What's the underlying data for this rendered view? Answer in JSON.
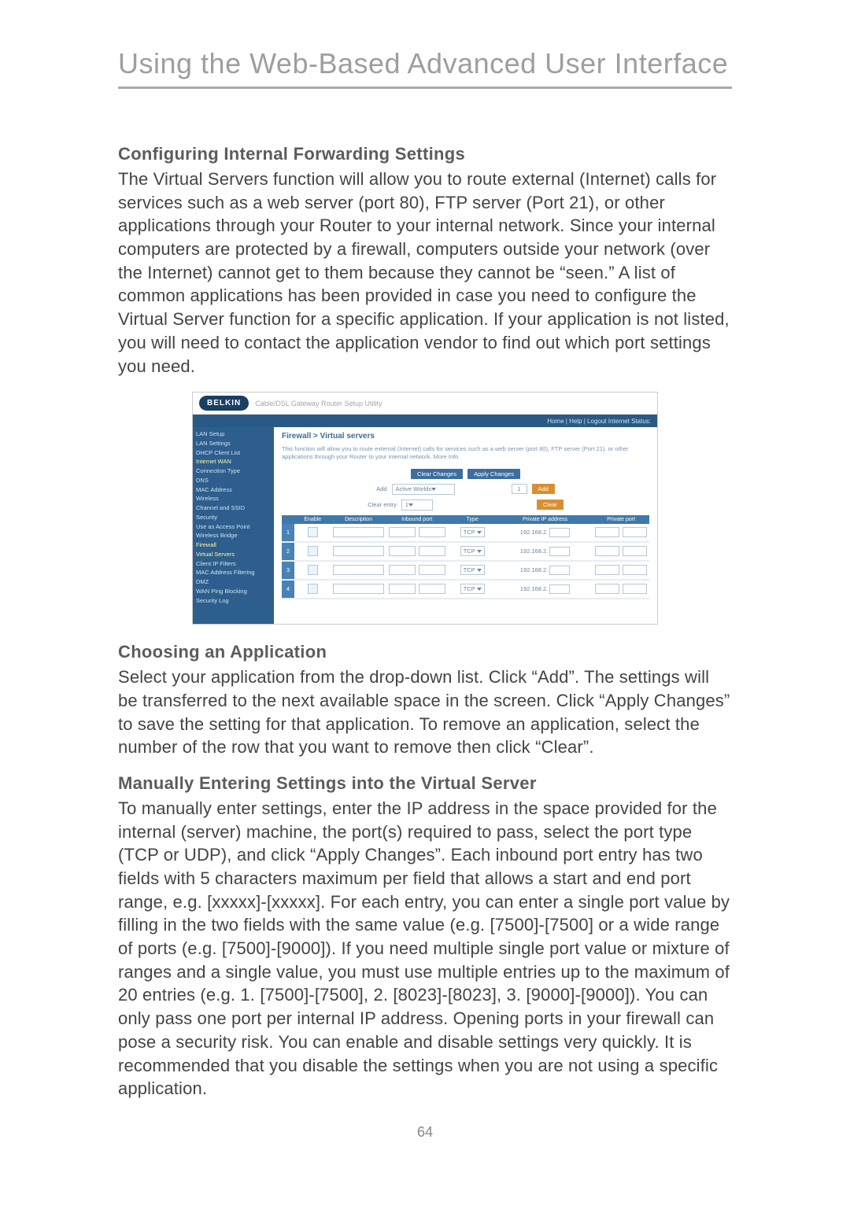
{
  "page": {
    "title": "Using the Web-Based Advanced User Interface",
    "number": "64"
  },
  "sections": {
    "s1_heading": "Configuring Internal Forwarding Settings",
    "s1_body": "The Virtual Servers function will allow you to route external (Internet) calls for services such as a web server (port 80), FTP server (Port 21), or other applications through your Router to your internal network. Since your internal computers are protected by a firewall, computers outside your network (over the Internet) cannot get to them because they cannot be “seen.” A list of common applications has been provided in case you need to configure the Virtual Server function for a specific application. If your application is not listed, you will need to contact the application vendor to find out which port settings you need.",
    "s2_heading": "Choosing an Application",
    "s2_body": "Select your application from the drop-down list. Click “Add”. The settings will be transferred to the next available space in the screen. Click “Apply Changes” to save the setting for that application. To remove an application, select the number of the row that you want to remove then click “Clear”.",
    "s3_heading": "Manually Entering Settings into the Virtual Server",
    "s3_body": "To manually enter settings, enter the IP address in the space provided for the internal (server) machine, the port(s) required to pass, select the port type (TCP or UDP), and click “Apply Changes”. Each inbound port entry has two fields with 5 characters maximum per field that allows a start and end port range, e.g. [xxxxx]-[xxxxx]. For each entry, you can enter a single port value by filling in the two fields with the same value (e.g. [7500]-[7500] or a wide range of ports (e.g. [7500]-[9000]). If you need multiple single port value or mixture of ranges and a single value, you must use multiple entries up to the maximum of 20 entries (e.g. 1. [7500]-[7500], 2. [8023]-[8023], 3. [9000]-[9000]). You can only pass one port per internal IP address. Opening ports in your firewall can pose a security risk. You can enable and disable settings very quickly. It is recommended that you disable the settings when you are not using a specific application."
  },
  "screenshot": {
    "logo": "BELKIN",
    "subtitle": "Cable/DSL Gateway Router Setup Utility",
    "nav": "Home | Help | Logout   Internet Status:",
    "sidebar": [
      "LAN Setup",
      "LAN Settings",
      "DHCP Client List",
      "Internet WAN",
      "Connection Type",
      "DNS",
      "MAC Address",
      "Wireless",
      "Channel and SSID",
      "Security",
      "Use as Access Point",
      "Wireless Bridge",
      "Firewall",
      "Virtual Servers",
      "Client IP Filters",
      "MAC Address Filtering",
      "DMZ",
      "WAN Ping Blocking",
      "Security Log"
    ],
    "main_title": "Firewall > Virtual servers",
    "main_desc": "This function will allow you to route external (Internet) calls for services such as a web server (port 80), FTP server (Port 21), or other applications through your Router to your internal network. More Info",
    "btn_clear": "Clear Changes",
    "btn_apply": "Apply Changes",
    "add_label": "Add",
    "add_option": "Active Worlds",
    "clear_label": "Clear entry",
    "clear_value": "1",
    "btn_add": "Add",
    "btn_clear2": "Clear",
    "table_headers": [
      "",
      "Enable",
      "Description",
      "Inbound port",
      "Type",
      "Private IP address",
      "Private port"
    ],
    "type_value": "TCP",
    "ip_prefix": "192.168.2.",
    "rows": [
      "1",
      "2",
      "3",
      "4"
    ]
  }
}
